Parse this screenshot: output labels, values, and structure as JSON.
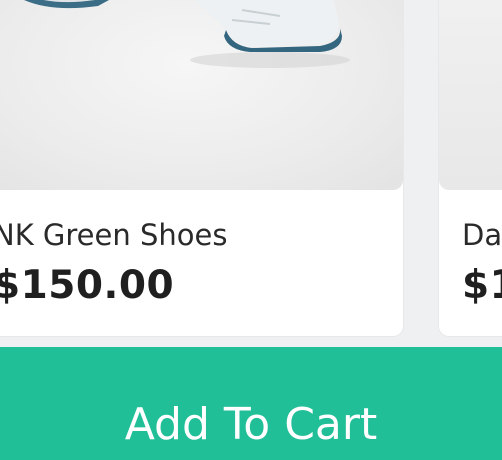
{
  "products": [
    {
      "title": "NK Green Shoes",
      "price": "$150.00",
      "image_icon": "sneaker-image"
    },
    {
      "title": "Da",
      "price": "$1"
    }
  ],
  "cart_button": {
    "label": "Add To Cart"
  },
  "colors": {
    "accent": "#21bf98",
    "background": "#eef0f2",
    "card": "#ffffff"
  }
}
